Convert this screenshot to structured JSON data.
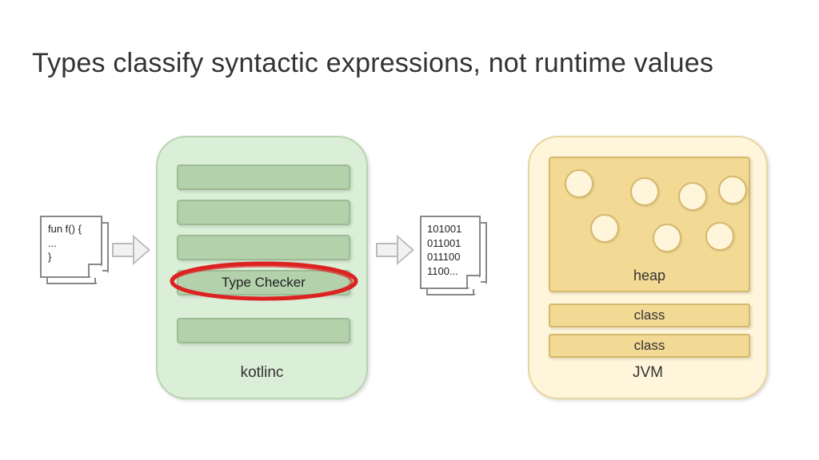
{
  "title": "Types classify syntactic expressions, not runtime values",
  "source": {
    "line1": "fun f() {",
    "line2": "  ...",
    "line3": "}"
  },
  "kotlinc": {
    "label": "kotlinc",
    "type_checker": "Type Checker"
  },
  "bytecode": {
    "line1": "101001",
    "line2": "011001",
    "line3": "011100",
    "line4": "1100..."
  },
  "jvm": {
    "label": "JVM",
    "heap_label": "heap",
    "class_label": "class"
  }
}
